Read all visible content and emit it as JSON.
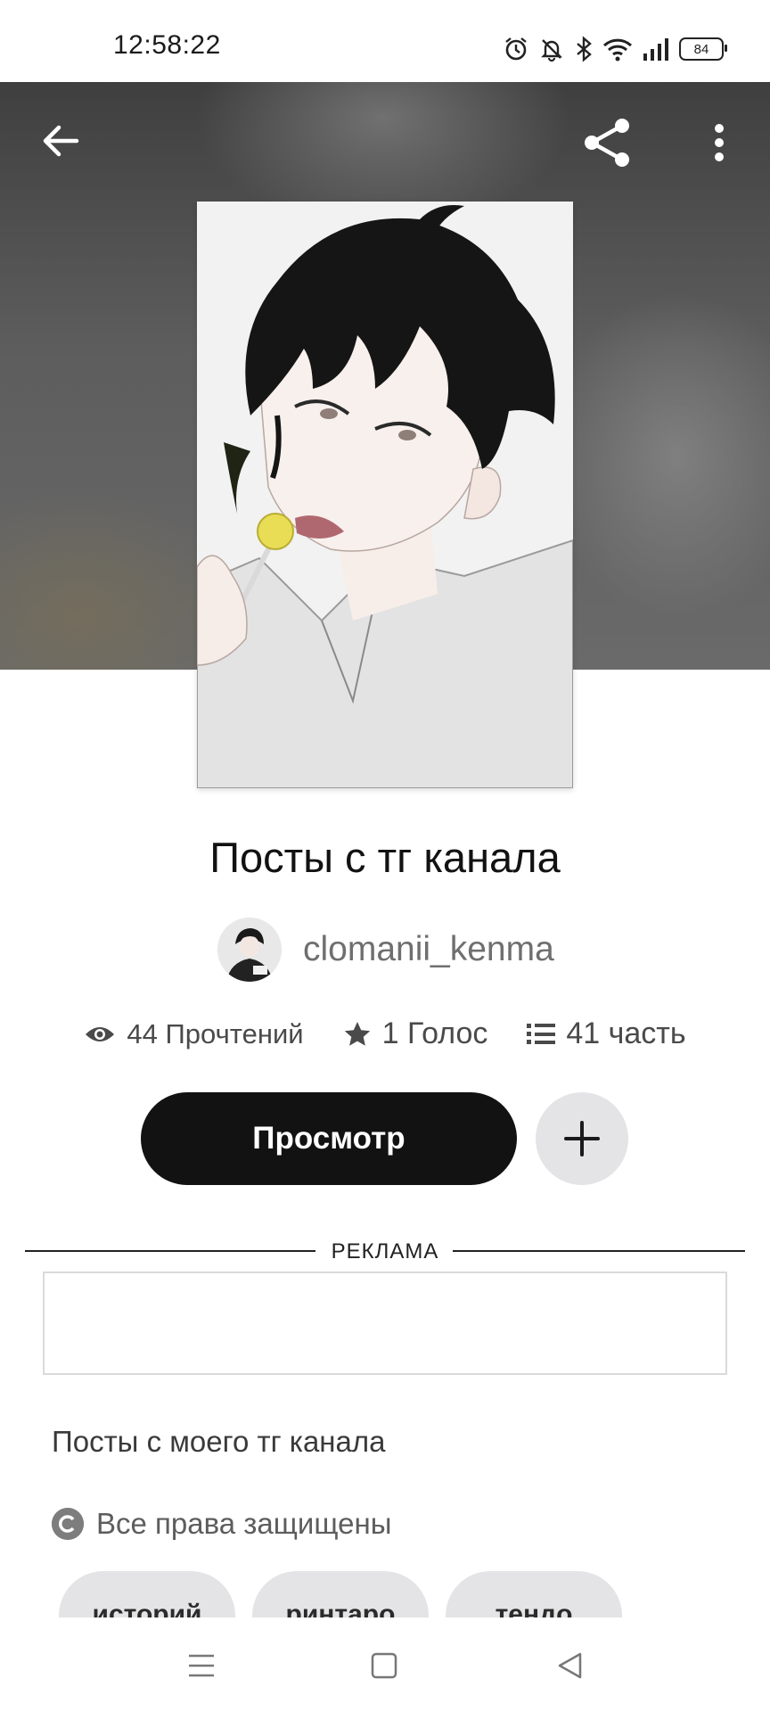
{
  "status_bar": {
    "time": "12:58:22",
    "battery": "84",
    "icons": [
      "alarm-icon",
      "bell-off-icon",
      "bluetooth-icon",
      "wifi-icon",
      "signal-icon",
      "battery-icon"
    ]
  },
  "toolbar": {
    "icons": [
      "back-arrow-icon",
      "share-icon",
      "more-vertical-icon"
    ]
  },
  "story": {
    "title": "Посты с тг канала",
    "author": "clomanii_kenma",
    "stats": {
      "reads": "44 Прочтений",
      "votes": "1 Голос",
      "parts": "41 часть"
    },
    "read_button": "Просмотр",
    "ad_label": "РЕКЛАМА",
    "description": "Посты с моего тг канала",
    "copyright": "Все права защищены",
    "tags": [
      "историй",
      "ринтаро",
      "тендо"
    ]
  },
  "colors": {
    "primary_button": "#121212",
    "secondary_button": "#e4e4e6",
    "muted_text": "#6f6f6f"
  },
  "nav_bar": {
    "icons": [
      "menu-icon",
      "home-square-icon",
      "back-triangle-icon"
    ]
  }
}
